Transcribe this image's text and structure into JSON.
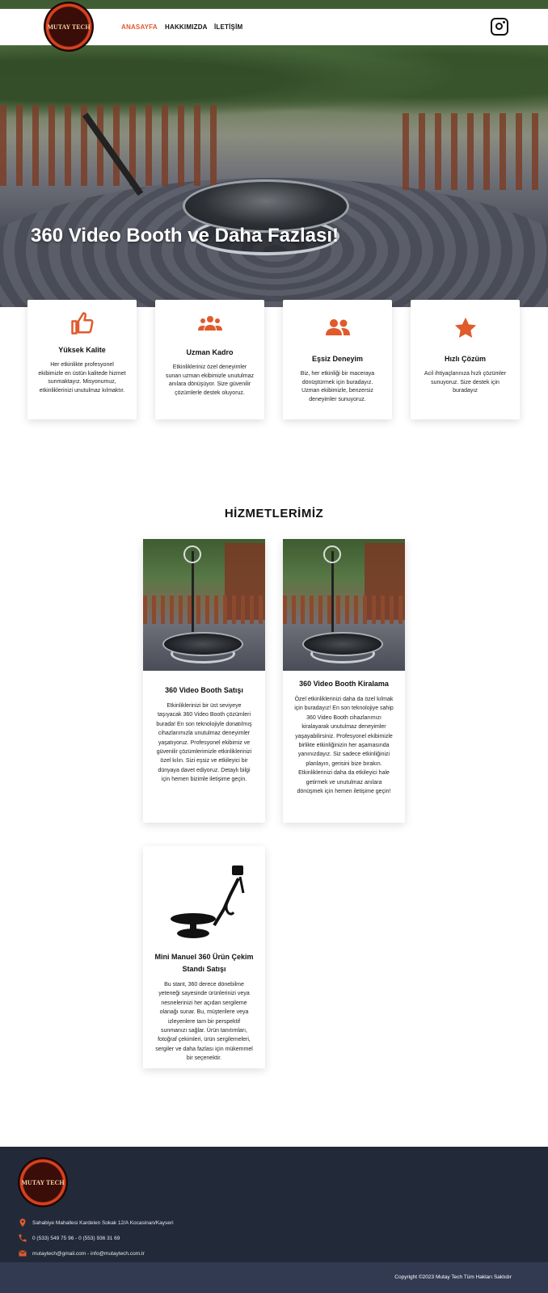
{
  "logo_text": "MUTAY TECH",
  "nav": {
    "items": [
      {
        "label": "ANASAYFA",
        "active": true
      },
      {
        "label": "HAKKIMIZDA",
        "active": false
      },
      {
        "label": "İLETİŞİM",
        "active": false
      }
    ],
    "social_icon": "instagram-icon"
  },
  "hero": {
    "title": "360 Video Booth ve Daha Fazlası!"
  },
  "colors": {
    "accent": "#e05a2c",
    "footer_bg": "#222a39",
    "copyright_bg": "#313a50"
  },
  "features": [
    {
      "icon": "thumbs-up-icon",
      "title": "Yüksek Kalite",
      "text": "Her etkinlikte profesyonel ekibimizle en üstün kalitede hizmet sunmaktayız. Misyonumuz, etkinliklerinizi unutulmaz kılmaktır."
    },
    {
      "icon": "team-icon",
      "title": "Uzman Kadro",
      "text": "Etkinlikleriniz özel deneyimler sunan uzman ekibimizle unutulmaz anılara dönüşüyor. Size güvenilir çözümlerle destek oluyoruz."
    },
    {
      "icon": "users-icon",
      "title": "Eşsiz Deneyim",
      "text": "Biz, her etkinliği bir maceraya dönüştürmek için buradayız. Uzman ekibimizle, benzersiz deneyimler sunuyoruz."
    },
    {
      "icon": "star-icon",
      "title": "Hızlı Çözüm",
      "text": "Acil ihtiyaçlarınıza hızlı çözümler sunuyoruz. Size destek için buradayız"
    }
  ],
  "services": {
    "title": "HİZMETLERİMİZ",
    "items": [
      {
        "title": "360 Video Booth Satışı",
        "text": "Etkinliklerinizi bir üst seviyeye taşıyacak 360 Video Booth çözümleri burada! En son teknolojiyle donatılmış cihazlarımızla unutulmaz deneyimler yaşatıyoruz. Profesyonel ekibimiz ve güvenilir çözümlerimizle etkinliklerinizi özel kılın. Sizi eşsiz ve etkileyici bir dünyaya davet ediyoruz. Detaylı bilgi için hemen bizimle iletişime geçin."
      },
      {
        "title": "360 Video Booth Kiralama",
        "text": "Özel etkinliklerinizi daha da özel kılmak için buradayız! En son teknolojiye sahip 360 Video Booth cihazlarımızı kiralayarak unutulmaz deneyimler yaşayabilirsiniz. Profesyonel ekibimizle birlikte etkinliğinizin her aşamasında yanınızdayız. Siz sadece etkinliğinizi planlayın, gerisini bize bırakın. Etkinliklerinizi daha da etkileyici hale getirmek ve unutulmaz anılara dönüşmek için hemen iletişime geçin!"
      },
      {
        "title": "Mini Manuel 360 Ürün Çekim Standı Satışı",
        "text": "Bu stant, 360 derece dönebilme yeteneği sayesinde ürünlerinizi veya nesnelerinizi her açıdan sergileme olanağı sunar. Bu, müşterilere veya izleyenlere tam bir perspektif sunmanızı sağlar. Ürün tanıtımları, fotoğraf çekimleri, ürün sergilemeleri, sergiler ve daha fazlası için mükemmel bir seçenektir."
      }
    ]
  },
  "footer": {
    "address": "Sahabiye Mahallesi Kardelen Sokak 12/A Kocasinan/Kayseri",
    "phone": "0 (533) 549 75 96 - 0 (553) 936 31 69",
    "email": "mutaytech@gmail.com - info@mutaytech.com.tr",
    "copyright": "Copyright ©2023 Mutay Tech Tüm Hakları Saklıdır"
  }
}
